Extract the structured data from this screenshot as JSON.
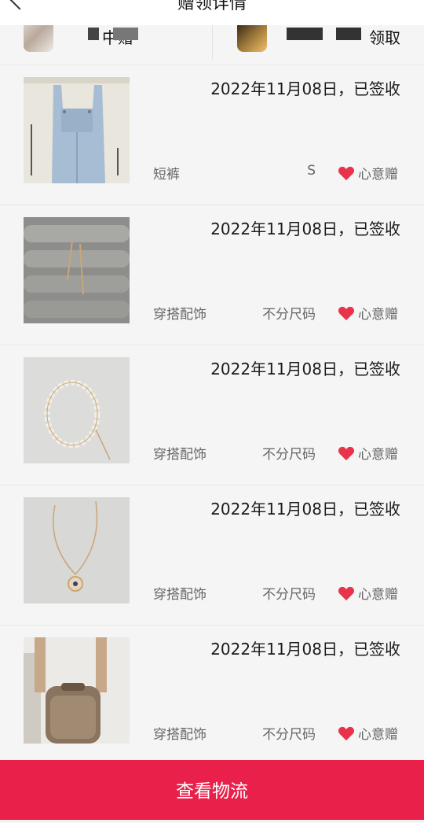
{
  "header": {
    "title": "赠领详情"
  },
  "users": {
    "left": {
      "label": "中赠"
    },
    "right": {
      "label": "领取"
    }
  },
  "items": [
    {
      "date": "2022年11月08日，已签收",
      "category": "短裤",
      "size": "S",
      "gift_label": "心意赠"
    },
    {
      "date": "2022年11月08日，已签收",
      "category": "穿搭配饰",
      "size": "不分尺码",
      "gift_label": "心意赠"
    },
    {
      "date": "2022年11月08日，已签收",
      "category": "穿搭配饰",
      "size": "不分尺码",
      "gift_label": "心意赠"
    },
    {
      "date": "2022年11月08日，已签收",
      "category": "穿搭配饰",
      "size": "不分尺码",
      "gift_label": "心意赠"
    },
    {
      "date": "2022年11月08日，已签收",
      "category": "穿搭配饰",
      "size": "不分尺码",
      "gift_label": "心意赠"
    }
  ],
  "footer": {
    "button_label": "查看物流"
  },
  "colors": {
    "accent": "#e8204a",
    "heart": "#e8334a"
  }
}
